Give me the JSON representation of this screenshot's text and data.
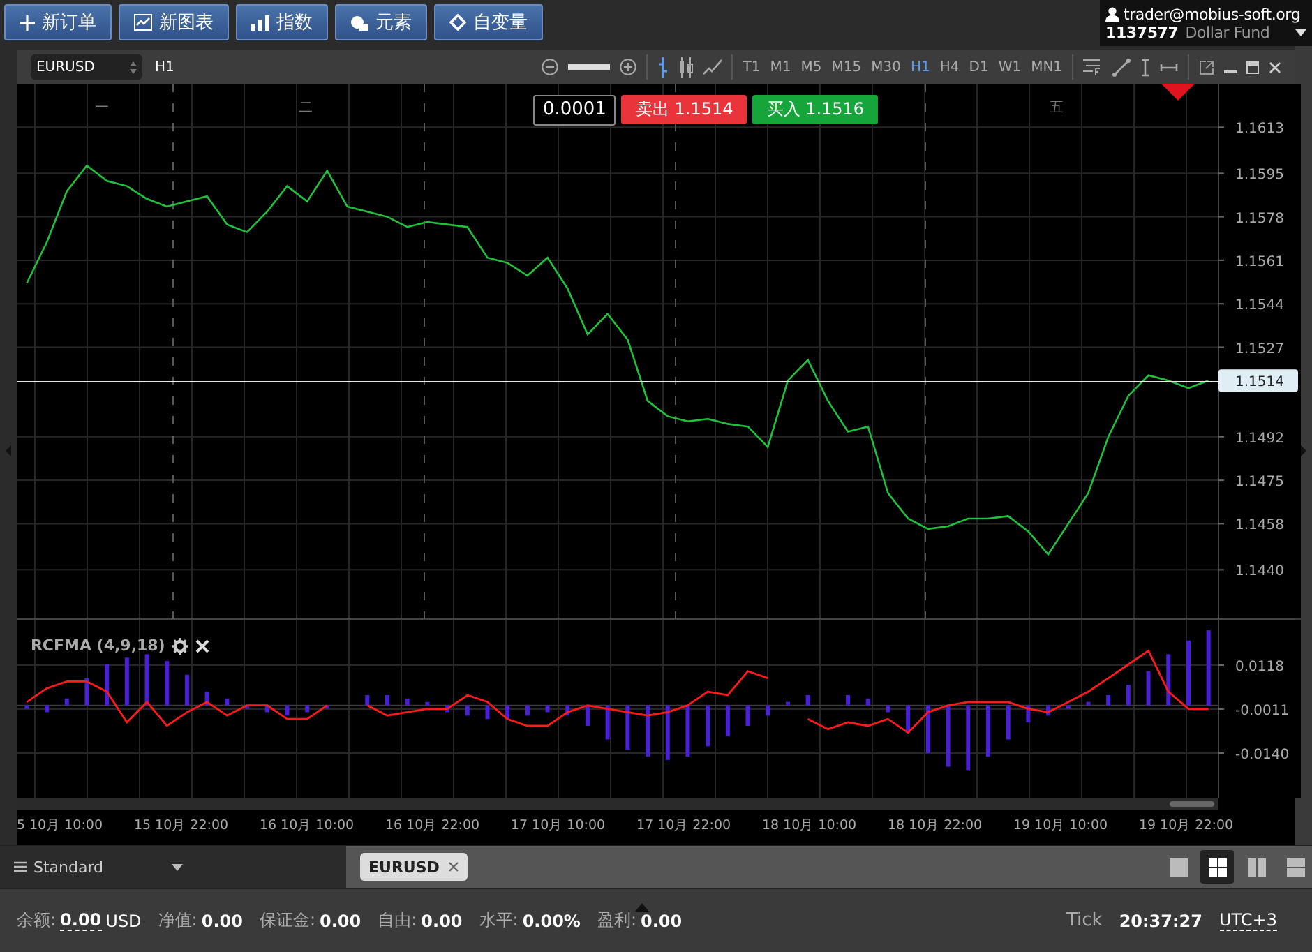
{
  "toolbar": {
    "buttons": [
      {
        "label": "新订单"
      },
      {
        "label": "新图表"
      },
      {
        "label": "指数"
      },
      {
        "label": "元素"
      },
      {
        "label": "自变量"
      }
    ]
  },
  "account": {
    "email": "trader@mobius-soft.org",
    "number": "1137577",
    "name": "Dollar Fund"
  },
  "chart_window": {
    "symbol": "EURUSD",
    "period": "H1",
    "zoom": {
      "level": 1
    },
    "chart_types": [
      {
        "kind": "bar",
        "selected": true
      },
      {
        "kind": "candle",
        "selected": false
      },
      {
        "kind": "line",
        "selected": false
      }
    ],
    "timeframes": [
      {
        "label": "T1",
        "selected": false
      },
      {
        "label": "M1",
        "selected": false
      },
      {
        "label": "M5",
        "selected": false
      },
      {
        "label": "M15",
        "selected": false
      },
      {
        "label": "M30",
        "selected": false
      },
      {
        "label": "H1",
        "selected": true
      },
      {
        "label": "H4",
        "selected": false
      },
      {
        "label": "D1",
        "selected": false
      },
      {
        "label": "W1",
        "selected": false
      },
      {
        "label": "MN1",
        "selected": false
      }
    ],
    "trade_panel": {
      "volume": "0.0001",
      "sell": {
        "label": "卖出",
        "price": "1.1514"
      },
      "buy": {
        "label": "买入",
        "price": "1.1516"
      }
    },
    "day_labels": [
      "一",
      "二",
      "五"
    ],
    "price_chart": {
      "chart_data": {
        "type": "line",
        "grid": true,
        "ylim": [
          1.1421,
          1.163
        ],
        "yticks": [
          {
            "value": 1.1613,
            "label": "1.1613"
          },
          {
            "value": 1.1595,
            "label": "1.1595"
          },
          {
            "value": 1.1578,
            "label": "1.1578"
          },
          {
            "value": 1.1561,
            "label": "1.1561"
          },
          {
            "value": 1.1544,
            "label": "1.1544"
          },
          {
            "value": 1.1527,
            "label": "1.1527"
          },
          {
            "value": 1.1492,
            "label": "1.1492"
          },
          {
            "value": 1.1475,
            "label": "1.1475"
          },
          {
            "value": 1.1458,
            "label": "1.1458"
          },
          {
            "value": 1.144,
            "label": "1.1440"
          }
        ],
        "series": [
          {
            "color": "#1fc23a",
            "values": [
              1.1552,
              1.1568,
              1.1588,
              1.1598,
              1.1592,
              1.159,
              1.1585,
              1.1582,
              1.1584,
              1.1586,
              1.1575,
              1.1572,
              1.158,
              1.159,
              1.1584,
              1.1596,
              1.1582,
              1.158,
              1.1578,
              1.1574,
              1.1576,
              1.1575,
              1.1574,
              1.1562,
              1.156,
              1.1555,
              1.1562,
              1.155,
              1.1532,
              1.154,
              1.153,
              1.1506,
              1.15,
              1.1498,
              1.1499,
              1.1497,
              1.1496,
              1.1488,
              1.1514,
              1.1522,
              1.1506,
              1.1494,
              1.1496,
              1.147,
              1.146,
              1.1456,
              1.1457,
              1.146,
              1.146,
              1.1461,
              1.1455,
              1.1446,
              1.1458,
              1.147,
              1.1492,
              1.1508,
              1.1516,
              1.1514,
              1.1511,
              1.1514
            ]
          }
        ],
        "ref_lines": [
          {
            "axis": "y",
            "value": 1.1514,
            "label": "1.1514"
          }
        ]
      }
    },
    "indicator": {
      "title": "RCFMA (4,9,18)",
      "chart_data": {
        "type": "bar",
        "grid": true,
        "ylim": [
          -0.0273,
          0.0251
        ],
        "yticks": [
          {
            "value": 0.0118,
            "label": "0.0118"
          },
          {
            "value": -0.0011,
            "label": "-0.0011"
          },
          {
            "value": -0.014,
            "label": "-0.0140"
          }
        ],
        "series": [
          {
            "color": "#4a1fd6",
            "values": [
              -0.001,
              -0.002,
              0.002,
              0.008,
              0.012,
              0.014,
              0.015,
              0.013,
              0.009,
              0.004,
              0.002,
              -0.001,
              -0.002,
              -0.003,
              -0.002,
              -0.001,
              null,
              0.003,
              0.003,
              0.002,
              0.001,
              -0.002,
              -0.003,
              -0.004,
              -0.004,
              -0.003,
              -0.002,
              -0.003,
              -0.006,
              -0.01,
              -0.013,
              -0.015,
              -0.016,
              -0.015,
              -0.012,
              -0.009,
              -0.006,
              -0.003,
              0.001,
              0.003,
              null,
              0.003,
              0.002,
              -0.002,
              -0.008,
              -0.014,
              -0.018,
              -0.019,
              -0.015,
              -0.01,
              -0.005,
              -0.003,
              -0.001,
              0.001,
              0.003,
              0.006,
              0.01,
              0.015,
              0.019,
              0.022
            ]
          },
          {
            "type": "line",
            "color": "#ff1a1a",
            "values": [
              0.001,
              0.005,
              0.007,
              0.007,
              0.004,
              -0.005,
              0.001,
              -0.006,
              -0.002,
              0.001,
              -0.003,
              0.0,
              0.0,
              -0.004,
              -0.004,
              0.0,
              null,
              0.0,
              -0.003,
              -0.002,
              -0.001,
              -0.001,
              0.003,
              0.001,
              -0.004,
              -0.006,
              -0.006,
              -0.002,
              0.0,
              -0.001,
              -0.002,
              -0.003,
              -0.002,
              0.0,
              0.004,
              0.003,
              0.01,
              0.008,
              null,
              -0.004,
              -0.007,
              -0.005,
              -0.006,
              -0.004,
              -0.008,
              -0.002,
              0.0,
              0.001,
              0.001,
              0.001,
              -0.001,
              -0.002,
              0.001,
              0.004,
              0.008,
              0.012,
              0.016,
              0.004,
              -0.001,
              -0.001
            ]
          }
        ]
      }
    },
    "time_axis": [
      "5 10月 10:00",
      "15 10月 22:00",
      "16 10月 10:00",
      "16 10月 22:00",
      "17 10月 10:00",
      "17 10月 22:00",
      "18 10月 10:00",
      "18 10月 22:00",
      "19 10月 10:00",
      "19 10月 22:00"
    ]
  },
  "workspace": {
    "name": "Standard",
    "tabs": [
      {
        "label": "EURUSD",
        "selected": true
      }
    ],
    "layouts": [
      {
        "kind": "single",
        "selected": false
      },
      {
        "kind": "grid",
        "selected": true
      },
      {
        "kind": "columns",
        "selected": false
      },
      {
        "kind": "rows",
        "selected": false
      }
    ]
  },
  "status_bar": {
    "fields": [
      {
        "label": "余额:",
        "value": "0.00",
        "unit": "USD"
      },
      {
        "label": "净值:",
        "value": "0.00"
      },
      {
        "label": "保证金:",
        "value": "0.00"
      },
      {
        "label": "自由:",
        "value": "0.00"
      },
      {
        "label": "水平:",
        "value": "0.00%"
      },
      {
        "label": "盈利:",
        "value": "0.00"
      }
    ],
    "tick_label": "Tick",
    "time": "20:37:27",
    "timezone": "UTC+3"
  }
}
